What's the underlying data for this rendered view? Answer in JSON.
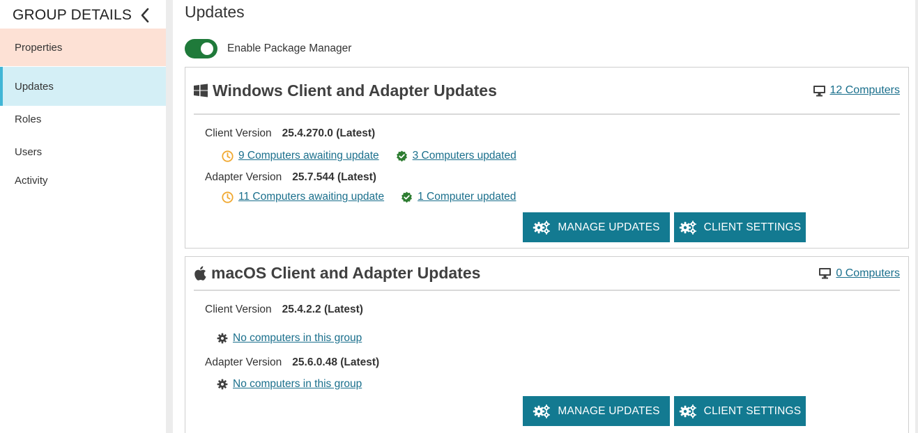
{
  "sidebar": {
    "title": "GROUP DETAILS",
    "items": [
      {
        "label": "Properties"
      },
      {
        "label": "Updates"
      },
      {
        "label": "Roles"
      },
      {
        "label": "Users"
      },
      {
        "label": "Activity"
      }
    ],
    "active": "Updates"
  },
  "main": {
    "title": "Updates",
    "toggle": {
      "label": "Enable Package Manager",
      "on": true,
      "color": "#1f7a3a"
    },
    "windows": {
      "title": "Windows Client and Adapter Updates",
      "computers_link": "12 Computers",
      "client": {
        "label": "Client Version",
        "value": "25.4.270.0 (Latest)",
        "awaiting": "9 Computers awaiting update",
        "updated": "3 Computers updated"
      },
      "adapter": {
        "label": "Adapter Version",
        "value": "25.7.544 (Latest)",
        "awaiting": "11 Computers awaiting update",
        "updated": "1 Computer updated"
      },
      "manage_button": "MANAGE UPDATES",
      "settings_button": "CLIENT SETTINGS"
    },
    "macos": {
      "title": "macOS Client and Adapter Updates",
      "computers_link": "0 Computers",
      "client": {
        "label": "Client Version",
        "value": "25.4.2.2 (Latest)",
        "status": "No computers in this group"
      },
      "adapter": {
        "label": "Adapter Version",
        "value": "25.6.0.48 (Latest)",
        "status": "No computers in this group"
      },
      "manage_button": "MANAGE UPDATES",
      "settings_button": "CLIENT SETTINGS"
    }
  },
  "colors": {
    "accent": "#137a91",
    "link": "#1a6f8c",
    "active_nav_bg": "#d4eff6",
    "active_nav_border": "#41b6d6",
    "properties_bg": "#fde1d5",
    "pending_icon": "#f0a830",
    "updated_icon": "#2e7d32"
  },
  "icons": {
    "collapse": "chevron-left-icon",
    "windows": "windows-logo-icon",
    "apple": "apple-logo-icon",
    "monitor": "monitor-icon",
    "clock": "clock-icon",
    "verified": "verified-badge-icon",
    "gear": "gear-icon",
    "gears": "gears-icon"
  }
}
